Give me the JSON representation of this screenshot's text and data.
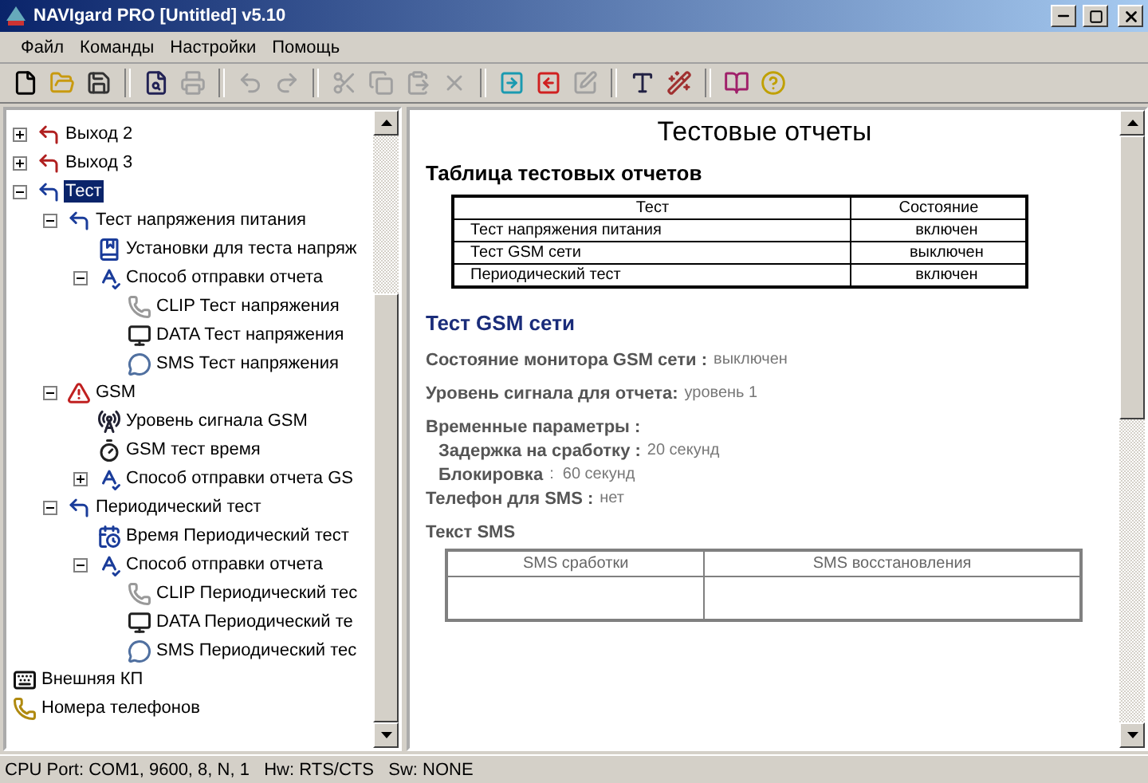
{
  "window": {
    "title": "NAVIgard PRO [Untitled]  v5.10"
  },
  "menu": [
    "Файл",
    "Команды",
    "Настройки",
    "Помощь"
  ],
  "toolbar": [
    {
      "kind": "new",
      "disabled": false
    },
    {
      "kind": "open",
      "disabled": false
    },
    {
      "kind": "save",
      "disabled": false
    },
    {
      "kind": "sep"
    },
    {
      "kind": "preview",
      "disabled": false
    },
    {
      "kind": "print",
      "disabled": true
    },
    {
      "kind": "sep"
    },
    {
      "kind": "undo",
      "disabled": true
    },
    {
      "kind": "redo",
      "disabled": true
    },
    {
      "kind": "sep"
    },
    {
      "kind": "cut",
      "disabled": true
    },
    {
      "kind": "copy",
      "disabled": true
    },
    {
      "kind": "paste",
      "disabled": true
    },
    {
      "kind": "delete",
      "disabled": true
    },
    {
      "kind": "sep"
    },
    {
      "kind": "upload",
      "disabled": false
    },
    {
      "kind": "download",
      "disabled": false
    },
    {
      "kind": "edit",
      "disabled": true
    },
    {
      "kind": "sep"
    },
    {
      "kind": "font",
      "disabled": false
    },
    {
      "kind": "wand",
      "disabled": false
    },
    {
      "kind": "sep"
    },
    {
      "kind": "book",
      "disabled": false
    },
    {
      "kind": "help",
      "disabled": false
    }
  ],
  "tree": [
    {
      "label": "Выход 2",
      "kind": "output",
      "expanded": false,
      "selected": false
    },
    {
      "label": "Выход 3",
      "kind": "output",
      "expanded": false,
      "selected": false
    },
    {
      "label": "Тест",
      "kind": "test",
      "expanded": true,
      "selected": true,
      "children": [
        {
          "label": "Тест напряжения питания",
          "kind": "test",
          "expanded": true,
          "selected": false,
          "children": [
            {
              "label": "Установки для теста напряж",
              "kind": "book",
              "selected": false
            },
            {
              "label": "Способ отправки отчета",
              "kind": "abc",
              "expanded": true,
              "selected": false,
              "children": [
                {
                  "label": "CLIP Тест напряжения",
                  "kind": "clip",
                  "selected": false
                },
                {
                  "label": "DATA Тест напряжения",
                  "kind": "data",
                  "selected": false
                },
                {
                  "label": "SMS Тест напряжения",
                  "kind": "sms",
                  "selected": false
                }
              ]
            }
          ]
        },
        {
          "label": "GSM",
          "kind": "gsm",
          "expanded": true,
          "selected": false,
          "children": [
            {
              "label": "Уровень сигнала GSM",
              "kind": "antenna",
              "selected": false
            },
            {
              "label": "GSM тест время",
              "kind": "timer",
              "selected": false
            },
            {
              "label": "Способ отправки отчета GS",
              "kind": "abc",
              "expanded": false,
              "selected": false
            }
          ]
        },
        {
          "label": "Периодический тест",
          "kind": "test",
          "expanded": true,
          "selected": false,
          "children": [
            {
              "label": "Время Периодический тест",
              "kind": "calendar",
              "selected": false
            },
            {
              "label": "Способ отправки отчета",
              "kind": "abc",
              "expanded": true,
              "selected": false,
              "children": [
                {
                  "label": "CLIP Периодический тес",
                  "kind": "clip",
                  "selected": false
                },
                {
                  "label": "DATA Периодический те",
                  "kind": "data",
                  "selected": false
                },
                {
                  "label": "SMS Периодический тес",
                  "kind": "sms",
                  "selected": false
                }
              ]
            }
          ]
        }
      ]
    },
    {
      "label": "Внешняя КП",
      "kind": "keypad",
      "selected": false
    },
    {
      "label": "Номера телефонов",
      "kind": "phone",
      "selected": false
    }
  ],
  "report": {
    "title": "Тестовые отчеты",
    "table_title": "Таблица тестовых отчетов",
    "table": {
      "columns": [
        "Тест",
        "Состояние"
      ],
      "rows": [
        [
          "Тест напряжения питания",
          "включен"
        ],
        [
          "Тест GSM сети",
          "выключен"
        ],
        [
          "Периодический тест",
          "включен"
        ]
      ]
    },
    "section_title": "Тест GSM сети",
    "fields": [
      {
        "kind": "field",
        "label": "Состояние монитора GSM сети :",
        "value": "выключен"
      },
      {
        "kind": "field",
        "label": "Уровень сигнала для отчета:",
        "value": "уровень 1"
      },
      {
        "kind": "group",
        "label": "Временные параметры :"
      },
      {
        "kind": "sub",
        "label": "Задержка на сработку :",
        "value": "20 секунд"
      },
      {
        "kind": "sub",
        "label": "Блокировка",
        "value": ":  60 секунд"
      },
      {
        "kind": "field",
        "label": "Телефон для SMS :",
        "value": "нет"
      },
      {
        "kind": "group",
        "label": "Текст SMS"
      }
    ],
    "sms_table": {
      "columns": [
        "SMS сработки",
        "SMS восстановления"
      ]
    }
  },
  "status_bar": "CPU Port: COM1, 9600, 8, N, 1   Hw: RTS/CTS   Sw: NONE"
}
